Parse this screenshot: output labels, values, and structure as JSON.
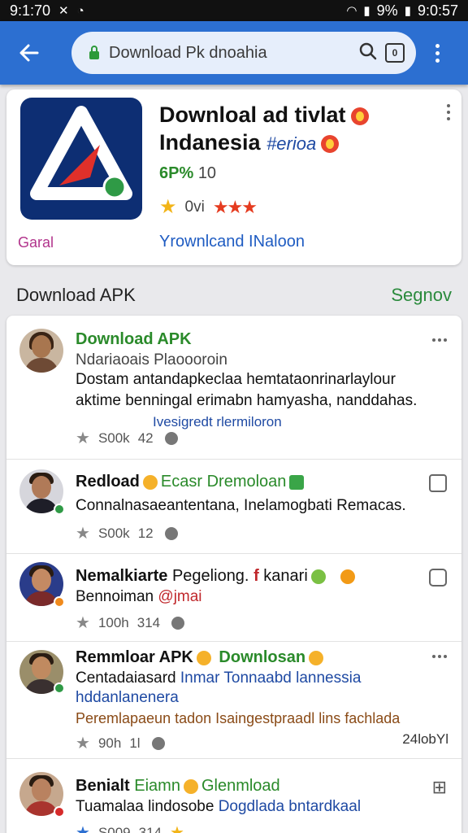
{
  "status_bar": {
    "time_left": "9:1:70",
    "battery": "9%",
    "time_right": "9:0:57"
  },
  "toolbar": {
    "url": "Download Pk dnoahia",
    "tab_count": "0"
  },
  "app": {
    "title_line1": "Downloal ad tivlat",
    "title_line2": "Indanesia",
    "region": "#erioa",
    "version_label": "6P%",
    "version_value": "10",
    "rating_text": "0vi",
    "tag": "Garal",
    "link": "Yrownlcand INaloon"
  },
  "section": {
    "title": "Download APK",
    "action": "Segnov"
  },
  "posts": [
    {
      "title": "Download APK",
      "subtitle": "Ndariaoais Plaoooroin",
      "body": "Dostam antandapkeclaa hemtataonrinarlaylour aktime benningal erimabn hamyasha, nanddahas.",
      "link": "Ivesigredt rlermiloron",
      "meta_count": "S00k",
      "meta_num": "42"
    },
    {
      "title": "Redload",
      "title_extra": "Ecasr Dremoloan",
      "body": "Connalnasaeantentana, Inelamogbati Remacas.",
      "meta_count": "S00k",
      "meta_num": "12"
    },
    {
      "title": "Nemalkiarte",
      "title_extra": "Pegeliong.",
      "title_red": "f",
      "title_tail": "kanari",
      "subtitle": "Bennoiman",
      "subtitle_red": "@jmai",
      "meta_count": "100h",
      "meta_num": "314"
    },
    {
      "title": "Remmloar APK",
      "title_extra": "Downlosan",
      "body_a": "Centadaiasard",
      "body_b": "Inmar Tonnaabd lannessia",
      "body_line2": "hddanlanenera",
      "body_line3": "Peremlapaeun tadon Isaingestpraadl lins fachlada",
      "meta_count": "90h",
      "meta_num": "1l",
      "meta_right": "24lobYl"
    },
    {
      "title": "Benialt",
      "title_extra": "Eiamn",
      "title_tail": "Glenmload",
      "body_a": "Tuamalaa lindosobe",
      "body_b": "Dogdlada bntardkaal",
      "meta_count": "S009",
      "meta_num": "314"
    }
  ]
}
